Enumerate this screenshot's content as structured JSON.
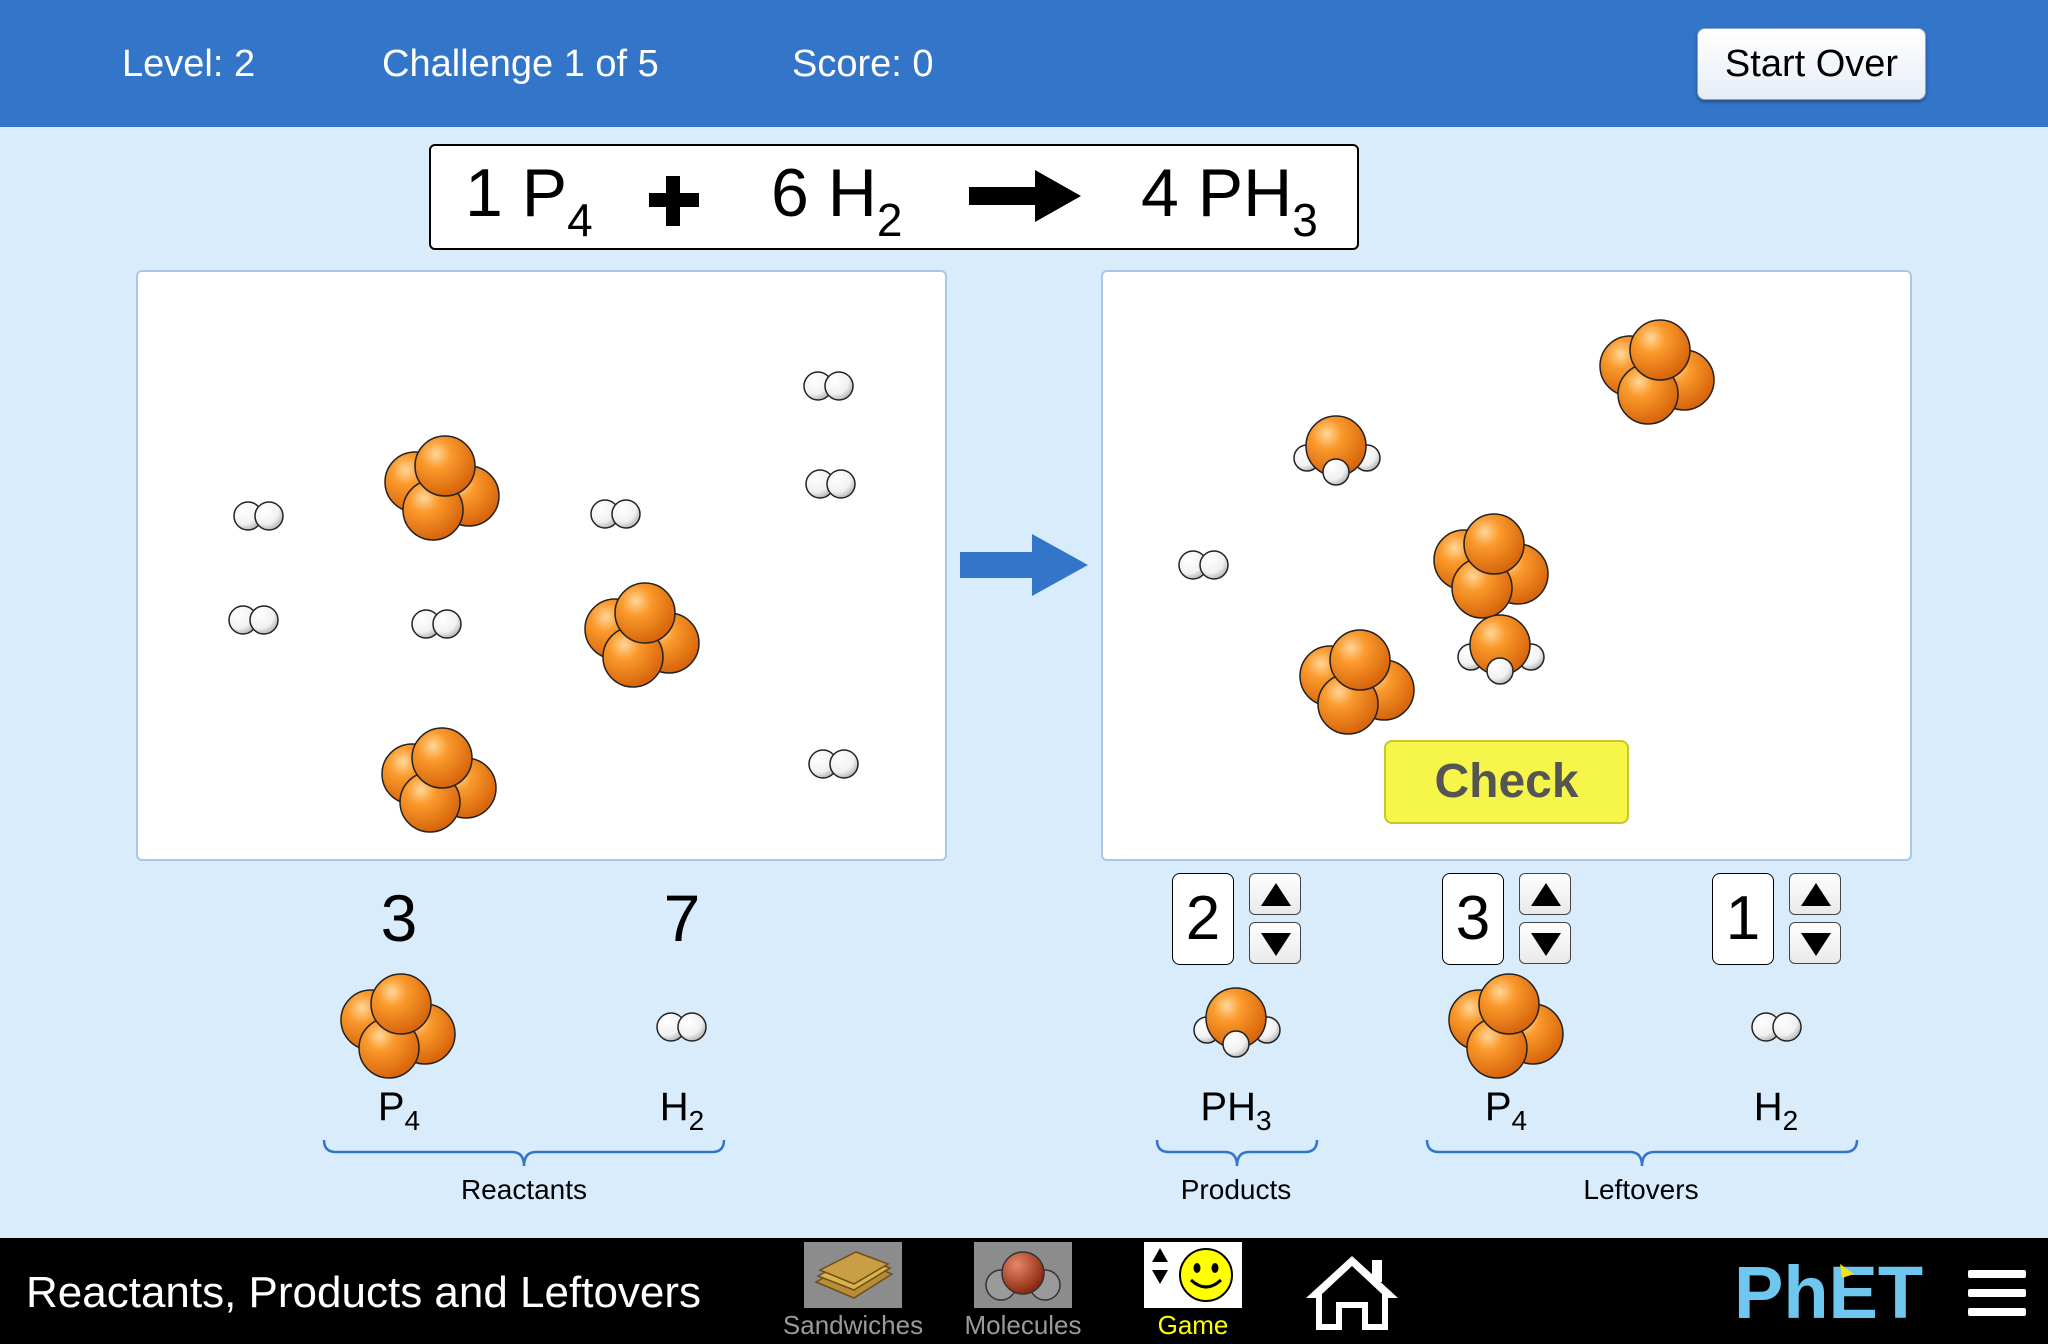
{
  "header": {
    "level": "Level: 2",
    "challenge": "Challenge 1 of 5",
    "score": "Score: 0",
    "start_over_label": "Start Over"
  },
  "equation": {
    "reactant1_coef": "1 P",
    "reactant1_sub": "4",
    "plus": "+",
    "reactant2_coef": "6 H",
    "reactant2_sub": "2",
    "product_coef": "4 PH",
    "product_sub": "3"
  },
  "reactants": {
    "group_label": "Reactants",
    "items": [
      {
        "count": "3",
        "formula": "P",
        "sub": "4"
      },
      {
        "count": "7",
        "formula": "H",
        "sub": "2"
      }
    ]
  },
  "products": {
    "group_label": "Products",
    "items": [
      {
        "count": "2",
        "formula": "PH",
        "sub": "3"
      }
    ]
  },
  "leftovers": {
    "group_label": "Leftovers",
    "items": [
      {
        "count": "3",
        "formula": "P",
        "sub": "4"
      },
      {
        "count": "1",
        "formula": "H",
        "sub": "2"
      }
    ]
  },
  "check_label": "Check",
  "footer": {
    "sim_title": "Reactants, Products and Leftovers",
    "nav": [
      {
        "label": "Sandwiches",
        "icon": "sandwich-icon"
      },
      {
        "label": "Molecules",
        "icon": "molecule-icon"
      },
      {
        "label": "Game",
        "icon": "game-smiley-icon"
      },
      {
        "label": "",
        "icon": "home-icon"
      }
    ],
    "brand": "PhET"
  },
  "colors": {
    "header_blue": "#3375c9",
    "background": "#d9ecfb",
    "phosphorus_orange": "#f58a1f",
    "check_yellow": "#f6f54a",
    "game_active": "#ffff00",
    "phet_blue": "#6fc6ee"
  }
}
